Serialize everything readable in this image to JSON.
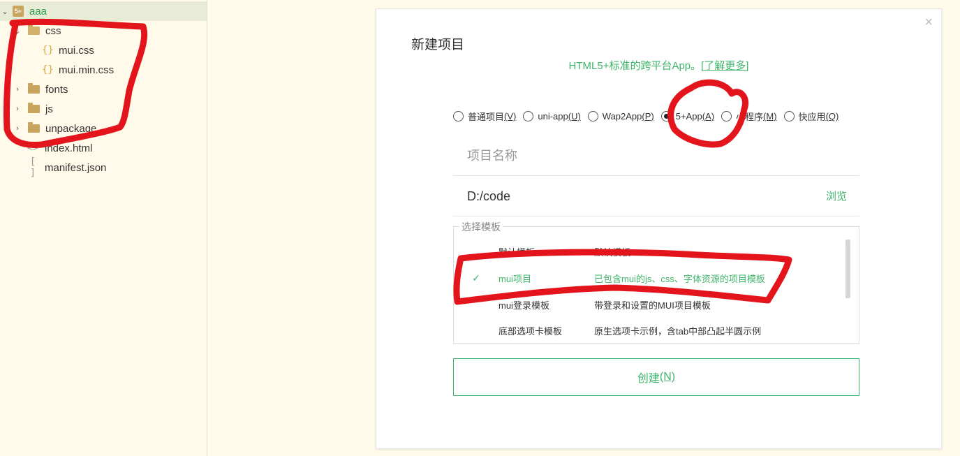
{
  "sidebar": {
    "project": {
      "icon_text": "5+",
      "label": "aaa"
    },
    "items": [
      {
        "label": "css"
      },
      {
        "label": "mui.css"
      },
      {
        "label": "mui.min.css"
      },
      {
        "label": "fonts"
      },
      {
        "label": "js"
      },
      {
        "label": "unpackage"
      },
      {
        "label": "index.html"
      },
      {
        "label": "manifest.json"
      }
    ]
  },
  "dialog": {
    "title": "新建项目",
    "subtitle": "HTML5+标准的跨平台App。",
    "learn_more": "[了解更多]",
    "project_types": [
      {
        "label": "普通项目",
        "key": "(V)",
        "checked": false
      },
      {
        "label": "uni-app",
        "key": "(U)",
        "checked": false
      },
      {
        "label": "Wap2App",
        "key": "(P)",
        "checked": false
      },
      {
        "label": "5+App",
        "key": "(A)",
        "checked": true
      },
      {
        "label": "小程序",
        "key": "(M)",
        "checked": false
      },
      {
        "label": "快应用",
        "key": "(Q)",
        "checked": false
      }
    ],
    "name_placeholder": "项目名称",
    "path_value": "D:/code",
    "browse_label": "浏览",
    "template_legend": "选择模板",
    "templates": [
      {
        "name": "默认模板",
        "desc": "默认模板",
        "selected": false
      },
      {
        "name": "mui项目",
        "desc": "已包含mui的js、css、字体资源的项目模板",
        "selected": true
      },
      {
        "name": "mui登录模板",
        "desc": "带登录和设置的MUI项目模板",
        "selected": false
      },
      {
        "name": "底部选项卡模板",
        "desc": "原生选项卡示例，含tab中部凸起半圆示例",
        "selected": false
      }
    ],
    "check_mark": "✓",
    "create_label": "创建",
    "create_key": "(N)",
    "close_glyph": "×"
  },
  "colors": {
    "accent": "#3fb56b",
    "sidebar_bg": "#fffae9",
    "annotation": "#e3141b"
  }
}
